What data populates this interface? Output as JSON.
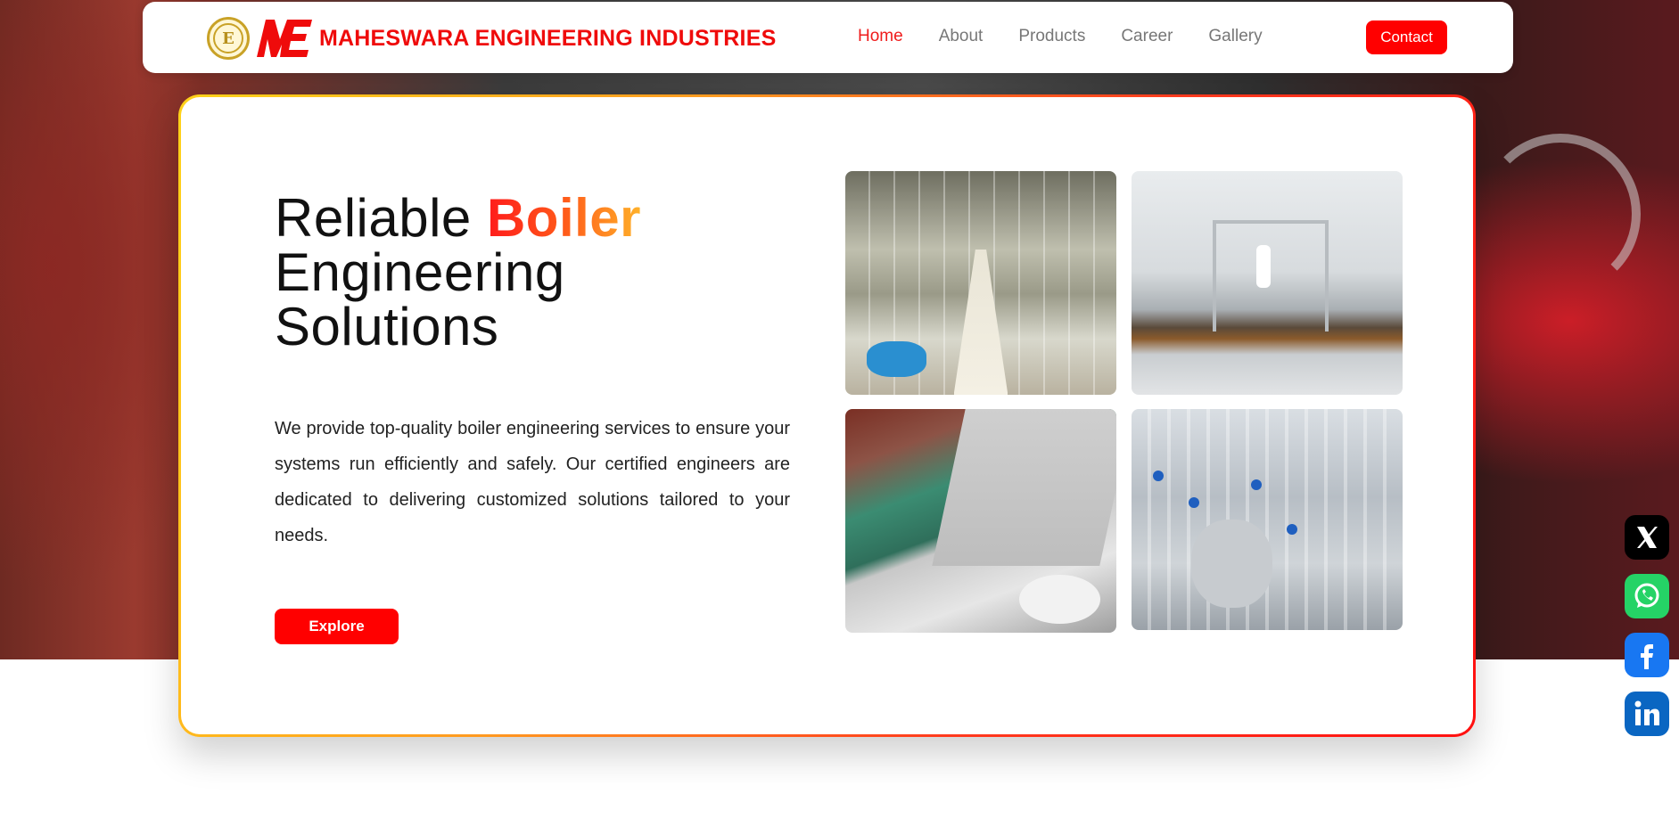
{
  "header": {
    "brand_monogram": "E",
    "brand_name": "MAHESWARA ENGINEERING INDUSTRIES",
    "nav": [
      {
        "label": "Home",
        "active": true
      },
      {
        "label": "About",
        "active": false
      },
      {
        "label": "Products",
        "active": false
      },
      {
        "label": "Career",
        "active": false
      },
      {
        "label": "Gallery",
        "active": false
      }
    ],
    "contact_label": "Contact"
  },
  "hero": {
    "headline_word1": "Reliable ",
    "headline_accent": "Boiler",
    "headline_line2": "Engineering",
    "headline_line3": "Solutions",
    "description": "We provide top-quality boiler engineering services to ensure your systems run efficiently and safely. Our certified engineers are dedicated to delivering customized solutions tailored to your needs.",
    "cta_label": "Explore"
  },
  "gallery": [
    {
      "icon": "factory-hall-photo"
    },
    {
      "icon": "lab-bottling-photo"
    },
    {
      "icon": "paper-roll-machine-photo"
    },
    {
      "icon": "stainless-piping-photo"
    }
  ],
  "social": [
    {
      "icon": "x-icon",
      "color": "#000000"
    },
    {
      "icon": "whatsapp-icon",
      "color": "#25d366"
    },
    {
      "icon": "facebook-icon",
      "color": "#1877f2"
    },
    {
      "icon": "linkedin-icon",
      "color": "#0a66c2"
    }
  ],
  "colors": {
    "accent": "#ff0000",
    "nav_active": "#ef1c1c",
    "nav_inactive": "#777777",
    "gradient_start": "#ffd21a",
    "gradient_end": "#ff1010"
  }
}
